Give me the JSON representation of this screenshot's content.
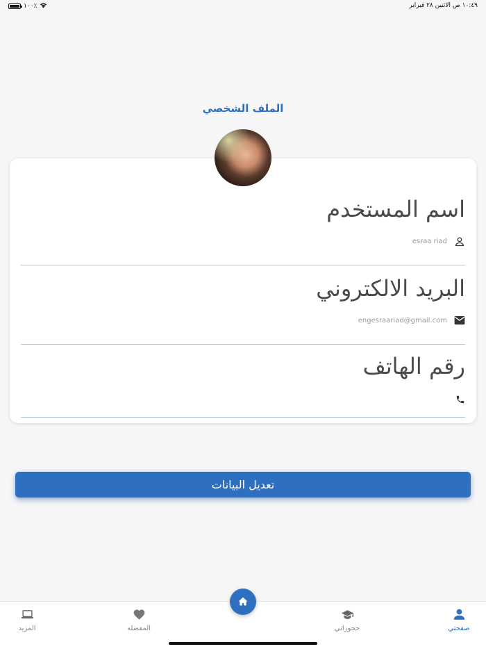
{
  "status_bar": {
    "battery_percent": "١٠٠٪",
    "datetime": "١٠:٤٩ ص   الاثنين ٢٨ فبراير"
  },
  "page_title": "الملف الشخصي",
  "profile": {
    "username_label": "اسم المستخدم",
    "username_value": "esraa riad",
    "email_label": "البريد الالكتروني",
    "email_value": "engesraariad@gmail.com",
    "phone_label": "رقم الهاتف",
    "phone_value": ""
  },
  "edit_button_label": "تعديل البيانات",
  "tabbar": {
    "more": "المزيد",
    "favorites": "المفضله",
    "bookings": "حجوزاتي",
    "my_page": "صفحتي"
  },
  "colors": {
    "accent": "#2f6fbf",
    "divider": "#a9c6dd"
  },
  "icons": {
    "username": "person-outline-icon",
    "email": "mail-icon",
    "phone": "phone-icon",
    "more": "laptop-icon",
    "favorites": "heart-icon",
    "bookings": "graduation-cap-icon",
    "my_page": "person-icon",
    "home": "home-icon"
  }
}
